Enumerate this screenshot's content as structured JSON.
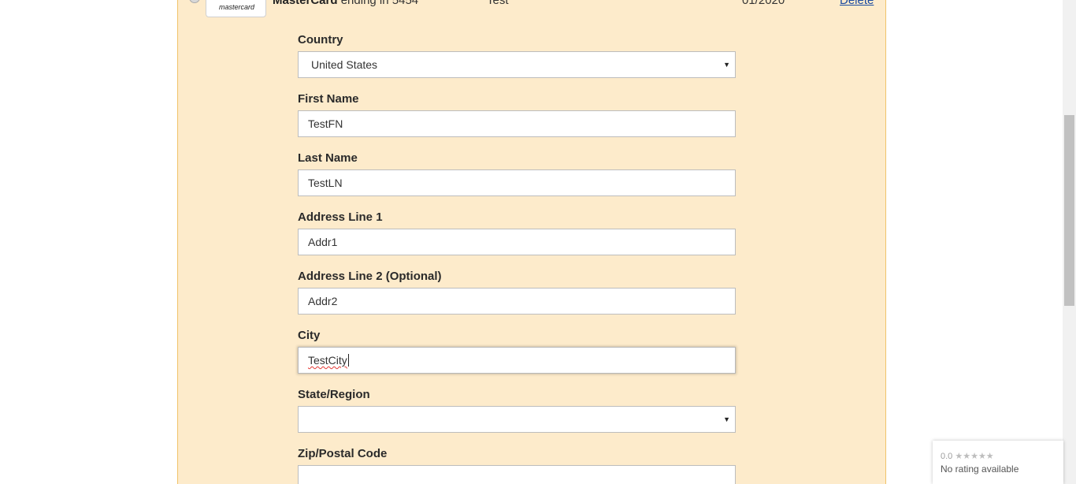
{
  "card": {
    "brand": "MasterCard",
    "ending_text": "ending in 5454",
    "logo_text": "mastercard",
    "name": "Test",
    "expiry": "01/2020",
    "delete_label": "Delete"
  },
  "form": {
    "country_label": "Country",
    "country_value": "United States",
    "first_name_label": "First Name",
    "first_name_value": "TestFN",
    "last_name_label": "Last Name",
    "last_name_value": "TestLN",
    "address1_label": "Address Line 1",
    "address1_value": "Addr1",
    "address2_label": "Address Line 2 (Optional)",
    "address2_value": "Addr2",
    "city_label": "City",
    "city_value": "TestCity",
    "state_label": "State/Region",
    "state_value": "",
    "zip_label": "Zip/Postal Code",
    "zip_value": ""
  },
  "rating_badge": {
    "score": "0.0",
    "stars": "★★★★★",
    "status": "No rating available"
  },
  "colors": {
    "panel_bg": "#fdebcb",
    "panel_border": "#f0c36a",
    "link": "#1a4ba0"
  }
}
